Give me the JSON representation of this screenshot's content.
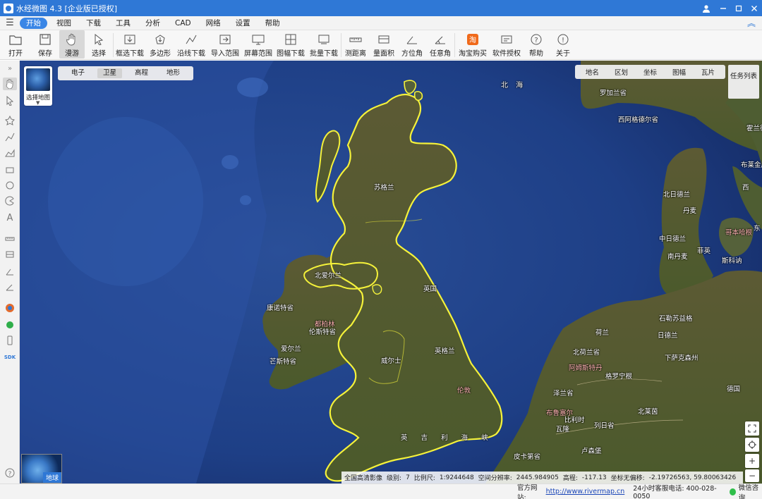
{
  "titlebar": {
    "title": "水经微图 4.3 [企业版已授权]"
  },
  "menu": {
    "items": [
      "开始",
      "视图",
      "下载",
      "工具",
      "分析",
      "CAD",
      "网络",
      "设置",
      "帮助"
    ]
  },
  "toolbar": {
    "items": [
      "打开",
      "保存",
      "漫游",
      "选择",
      "框选下载",
      "多边形",
      "沿线下载",
      "导入范围",
      "屏幕范围",
      "图幅下载",
      "批量下载",
      "测距离",
      "量面积",
      "方位角",
      "任意角",
      "淘宝购买",
      "软件授权",
      "帮助",
      "关于"
    ]
  },
  "map": {
    "select_map_label": "选择地图",
    "layer_tabs": [
      "电子",
      "卫星",
      "高程",
      "地形"
    ],
    "right_tabs": [
      "地名",
      "区划",
      "坐标",
      "图幅",
      "瓦片"
    ],
    "task_list": "任务列表",
    "minimap_label": "地球",
    "places": {
      "north_sea": "北 海",
      "scotland": "苏格兰",
      "north_ireland": "北爱尔兰",
      "england": "英国",
      "connacht": "康诺特省",
      "dublin": "都柏林",
      "leinster": "伦斯特省",
      "ireland": "爱尔兰",
      "munster": "芒斯特省",
      "wales": "威尔士",
      "englands": "英格兰",
      "london": "伦敦",
      "channel": "英 吉 利 海 峡",
      "norway_top": "罗加兰省",
      "west_agder": "西阿格德尔省",
      "north_jutland": "北日德兰",
      "central_jutland": "中日德兰",
      "denmark": "丹麦",
      "south_denmark": "南丹麦",
      "copenhagen": "哥本哈根",
      "sweden_south": "斯科讷",
      "fyn": "菲英",
      "netherlands": "荷兰",
      "north_holland": "北荷兰省",
      "amsterdam": "阿姆斯特丹",
      "groningen": "格罗宁根",
      "lower_saxony": "下萨克森州",
      "zeeland": "泽兰省",
      "brussels": "布鲁塞尔",
      "belgium": "比利时",
      "wallonia": "瓦隆",
      "liege": "列日省",
      "luxembourg": "卢森堡",
      "germany": "德国",
      "nrw": "北莱茵",
      "pas_de_calais": "皮卡第省",
      "schleswig": "石勒苏益格",
      "estonia_top": "霍兰德",
      "sweden_east": "布莱金厄",
      "vastra": "西",
      "denmark_east": "东",
      "jutland_dk": "日德兰"
    },
    "status": {
      "imagery": "全国高清影像",
      "level_label": "级别:",
      "level": "7",
      "scale_label": "比例尺:",
      "scale": "1:9244648",
      "resolution_label": "空间分辨率:",
      "resolution": "2445.984905",
      "elevation_label": "高程:",
      "elevation": "-117.13",
      "coord_label": "坐标无偏移:",
      "coord": "-2.19726563, 59.80063426"
    }
  },
  "bottom": {
    "site_label": "官方网站:",
    "site_url": "http://www.rivermap.cn",
    "phone": "24小时客服电话: 400-028-0050",
    "wechat": "微信咨询"
  },
  "colors": {
    "accent": "#2f78d6",
    "border_yellow": "#f5f23a",
    "sea": "#1f3a7a"
  }
}
